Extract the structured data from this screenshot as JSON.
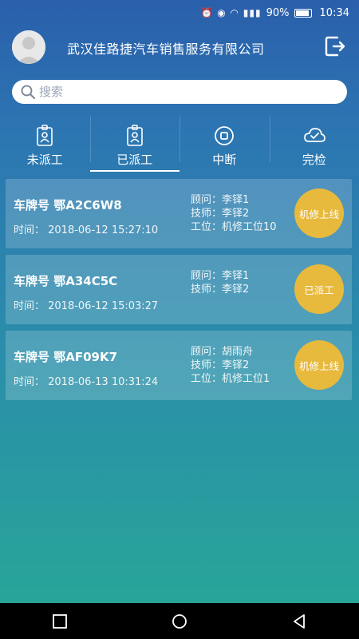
{
  "status_bar": {
    "battery": "90%",
    "time": "10:34"
  },
  "header": {
    "company": "武汉佳路捷汽车销售服务有限公司"
  },
  "search": {
    "placeholder": "搜索"
  },
  "tabs": [
    {
      "label": "未派工"
    },
    {
      "label": "已派工"
    },
    {
      "label": "中断"
    },
    {
      "label": "完检"
    }
  ],
  "orders": [
    {
      "plate": "车牌号 鄂A2C6W8",
      "time": "时间：  2018-06-12 15:27:10",
      "advisor": "顾问：李铎1",
      "tech": "技师：李铎2",
      "station": "工位：机修工位10",
      "status": "机修上线"
    },
    {
      "plate": "车牌号 鄂A34C5C",
      "time": "时间：  2018-06-12 15:03:27",
      "advisor": "顾问：李铎1",
      "tech": "技师：李铎2",
      "status": "已派工"
    },
    {
      "plate": "车牌号 鄂AF09K7",
      "time": "时间：  2018-06-13 10:31:24",
      "advisor": "顾问：胡雨舟",
      "tech": "技师：李铎2",
      "station": "工位：机修工位1",
      "status": "机修上线"
    }
  ],
  "colors": {
    "badge": "#e7b93d"
  }
}
